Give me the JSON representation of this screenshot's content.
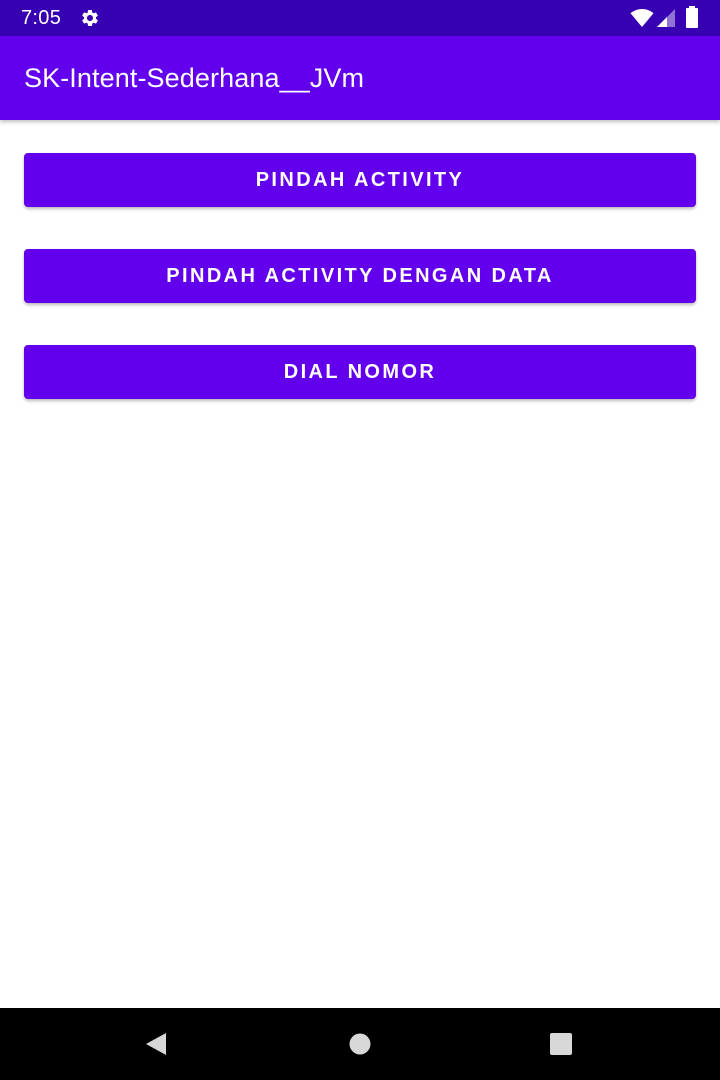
{
  "status_bar": {
    "time": "7:05",
    "icons": [
      "settings-gear-icon",
      "wifi-icon",
      "cell-signal-icon",
      "battery-icon"
    ],
    "background_color": "#3700b3"
  },
  "app_bar": {
    "title": "SK-Intent-Sederhana__JVm",
    "background_color": "#6200ee"
  },
  "buttons": [
    {
      "label": "PINDAH ACTIVITY"
    },
    {
      "label": "PINDAH ACTIVITY DENGAN DATA"
    },
    {
      "label": "DIAL NOMOR"
    }
  ],
  "button_color": "#6200ee",
  "nav_bar": {
    "icons": [
      "back-icon",
      "home-icon",
      "recents-icon"
    ]
  }
}
